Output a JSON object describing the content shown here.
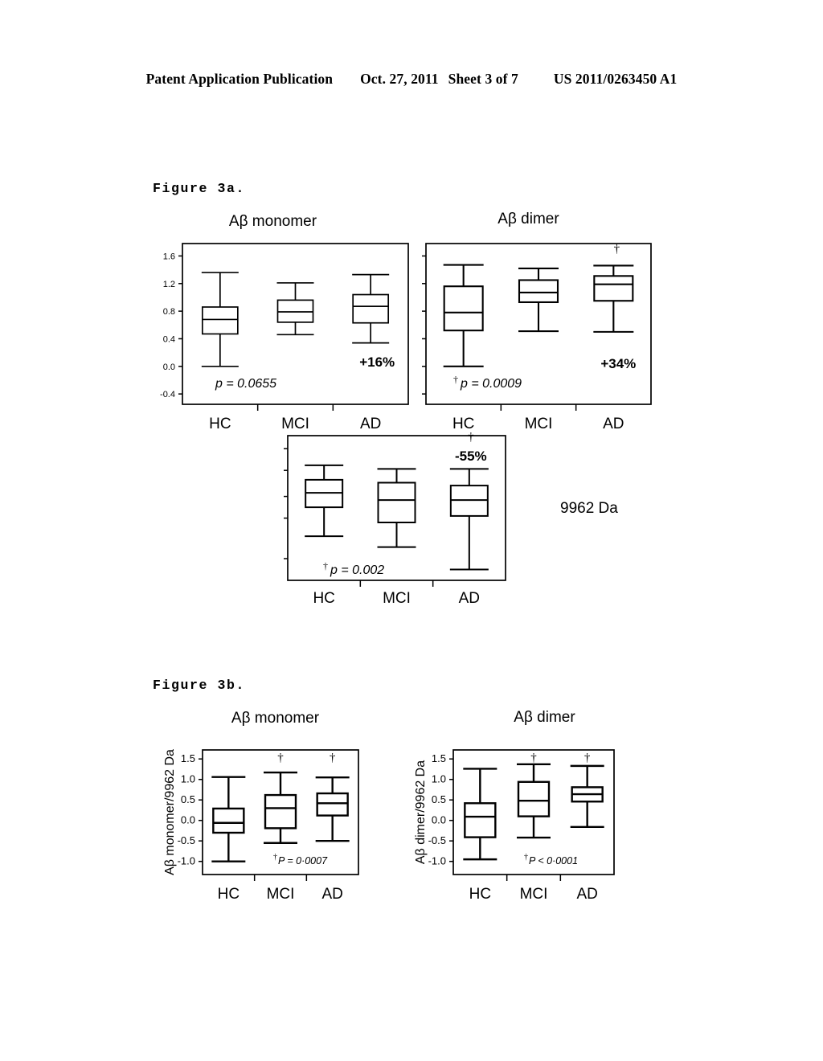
{
  "header": {
    "publication": "Patent Application Publication",
    "date": "Oct. 27, 2011",
    "sheet": "Sheet 3 of 7",
    "number": "US 2011/0263450 A1"
  },
  "figures": [
    {
      "id": "fig-3a",
      "caption": "Figure 3a."
    },
    {
      "id": "fig-3b",
      "caption": "Figure 3b."
    }
  ],
  "side_annotations": [
    {
      "id": "mass-label",
      "text": "9962 Da"
    }
  ],
  "categories": [
    "HC",
    "MCI",
    "AD"
  ],
  "chart_data": [
    {
      "id": "a-monomer",
      "type": "box",
      "figure": "Figure 3a.",
      "title": "Aβ monomer",
      "xlabel": "",
      "ylabel": "",
      "categories": [
        "HC",
        "MCI",
        "AD"
      ],
      "ylim": [
        -0.55,
        1.78
      ],
      "yticks": [
        1.6,
        1.2,
        0.8,
        0.4,
        0.0,
        -0.4
      ],
      "ytick_labels": [
        "1.6",
        "1.2",
        "0.8",
        "0.4",
        "0.0",
        "-0.4"
      ],
      "grid": false,
      "boxes": [
        {
          "category": "HC",
          "min": 0.0,
          "q1": 0.47,
          "median": 0.68,
          "q3": 0.86,
          "max": 1.36
        },
        {
          "category": "MCI",
          "min": 0.46,
          "q1": 0.64,
          "median": 0.79,
          "q3": 0.96,
          "max": 1.21
        },
        {
          "category": "AD",
          "min": 0.34,
          "q1": 0.63,
          "median": 0.87,
          "q3": 1.04,
          "max": 1.33
        }
      ],
      "annotations": [
        {
          "kind": "pvalue",
          "text": "p = 0.0655",
          "dagger": false
        },
        {
          "kind": "percent",
          "text": "+16%",
          "category": "AD"
        }
      ]
    },
    {
      "id": "a-dimer",
      "type": "box",
      "figure": "Figure 3a.",
      "title": "Aβ dimer",
      "xlabel": "",
      "ylabel": "",
      "categories": [
        "HC",
        "MCI",
        "AD"
      ],
      "ylim": [
        -0.55,
        1.78
      ],
      "yticks": [
        1.6,
        1.2,
        0.8,
        0.4,
        0.0,
        -0.4
      ],
      "ytick_labels": [
        "",
        "",
        "",
        "",
        "",
        ""
      ],
      "grid": false,
      "boxes": [
        {
          "category": "HC",
          "min": 0.0,
          "q1": 0.52,
          "median": 0.78,
          "q3": 1.16,
          "max": 1.47
        },
        {
          "category": "MCI",
          "min": 0.51,
          "q1": 0.93,
          "median": 1.07,
          "q3": 1.25,
          "max": 1.42
        },
        {
          "category": "AD",
          "min": 0.5,
          "q1": 0.95,
          "median": 1.19,
          "q3": 1.31,
          "max": 1.46
        }
      ],
      "annotations": [
        {
          "kind": "pvalue",
          "text": "p = 0.0009",
          "dagger": true
        },
        {
          "kind": "percent",
          "text": "+34%",
          "category": "AD"
        },
        {
          "kind": "dagger",
          "text": "†",
          "category": "AD"
        }
      ]
    },
    {
      "id": "a-9962",
      "type": "box",
      "figure": "Figure 3a.",
      "title": "",
      "xlabel": "",
      "ylabel": "",
      "categories": [
        "HC",
        "MCI",
        "AD"
      ],
      "ylim": [
        0,
        10
      ],
      "yticks": [
        9.1,
        7.6,
        5.8,
        4.3,
        1.5
      ],
      "ytick_labels": [
        "",
        "",
        "",
        "",
        ""
      ],
      "grid": false,
      "boxes": [
        {
          "category": "HC",
          "min": 3.05,
          "q1": 5.05,
          "median": 6.05,
          "q3": 6.95,
          "max": 7.95
        },
        {
          "category": "MCI",
          "min": 2.3,
          "q1": 4.0,
          "median": 5.55,
          "q3": 6.75,
          "max": 7.7
        },
        {
          "category": "AD",
          "min": 0.75,
          "q1": 4.45,
          "median": 5.55,
          "q3": 6.55,
          "max": 7.7
        }
      ],
      "annotations": [
        {
          "kind": "pvalue",
          "text": "p = 0.002",
          "dagger": true
        },
        {
          "kind": "percent",
          "text": "-55%",
          "category": "AD"
        },
        {
          "kind": "dagger",
          "text": "†",
          "category": "AD"
        }
      ]
    },
    {
      "id": "b-monomer",
      "type": "box",
      "figure": "Figure 3b.",
      "title": "Aβ monomer",
      "xlabel": "",
      "ylabel": "Aβ monomer/9962 Da",
      "categories": [
        "HC",
        "MCI",
        "AD"
      ],
      "ylim": [
        -1.32,
        1.72
      ],
      "yticks": [
        1.5,
        1.0,
        0.5,
        0.0,
        -0.5,
        -1.0
      ],
      "ytick_labels": [
        "1.5",
        "1.0",
        "0.5",
        "0.0",
        "-0.5",
        "-1.0"
      ],
      "grid": false,
      "boxes": [
        {
          "category": "HC",
          "min": -1.0,
          "q1": -0.3,
          "median": -0.06,
          "q3": 0.29,
          "max": 1.06
        },
        {
          "category": "MCI",
          "min": -0.55,
          "q1": -0.19,
          "median": 0.3,
          "q3": 0.62,
          "max": 1.17
        },
        {
          "category": "AD",
          "min": -0.5,
          "q1": 0.12,
          "median": 0.42,
          "q3": 0.66,
          "max": 1.05
        }
      ],
      "annotations": [
        {
          "kind": "pvalue",
          "text": "P = 0·0007",
          "dagger": true
        },
        {
          "kind": "dagger",
          "text": "†",
          "category": "MCI"
        },
        {
          "kind": "dagger",
          "text": "†",
          "category": "AD"
        }
      ]
    },
    {
      "id": "b-dimer",
      "type": "box",
      "figure": "Figure 3b.",
      "title": "Aβ dimer",
      "xlabel": "",
      "ylabel": "Aβ dimer/9962 Da",
      "categories": [
        "HC",
        "MCI",
        "AD"
      ],
      "ylim": [
        -1.32,
        1.72
      ],
      "yticks": [
        1.5,
        1.0,
        0.5,
        0.0,
        -0.5,
        -1.0
      ],
      "ytick_labels": [
        "1.5",
        "1.0",
        "0.5",
        "0.0",
        "-0.5",
        "-1.0"
      ],
      "grid": false,
      "boxes": [
        {
          "category": "HC",
          "min": -0.95,
          "q1": -0.41,
          "median": 0.09,
          "q3": 0.42,
          "max": 1.26
        },
        {
          "category": "MCI",
          "min": -0.42,
          "q1": 0.1,
          "median": 0.48,
          "q3": 0.94,
          "max": 1.37
        },
        {
          "category": "AD",
          "min": -0.16,
          "q1": 0.46,
          "median": 0.64,
          "q3": 0.81,
          "max": 1.33
        }
      ],
      "annotations": [
        {
          "kind": "pvalue",
          "text": "P < 0·0001",
          "dagger": true
        },
        {
          "kind": "dagger",
          "text": "†",
          "category": "MCI"
        },
        {
          "kind": "dagger",
          "text": "†",
          "category": "AD"
        }
      ]
    }
  ],
  "colors": {
    "ink": "#000000",
    "paper": "#ffffff"
  }
}
